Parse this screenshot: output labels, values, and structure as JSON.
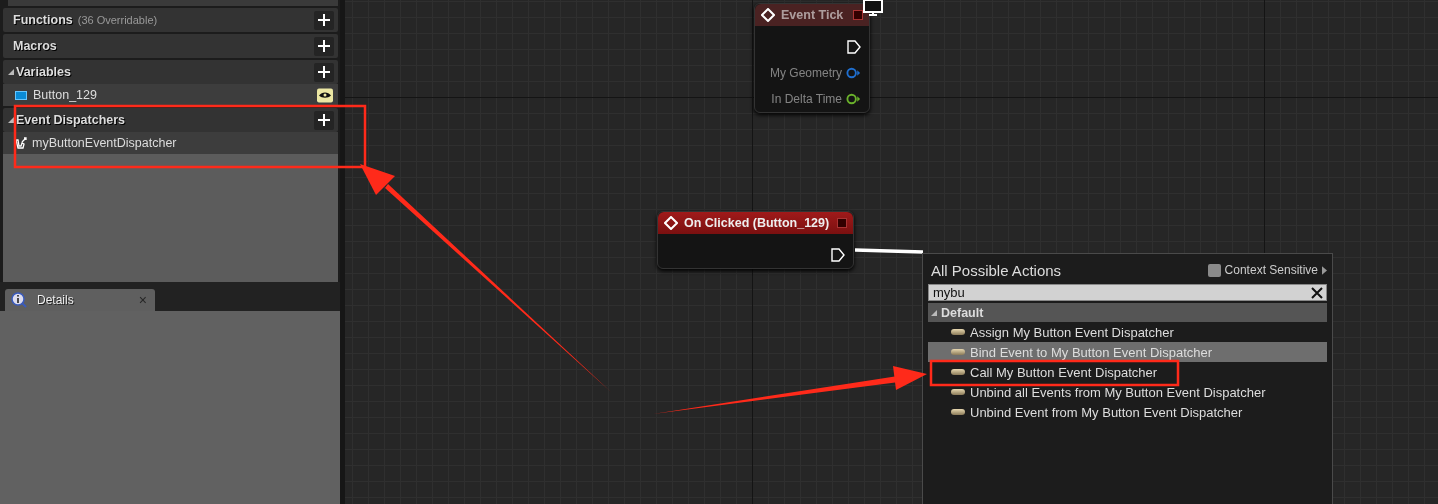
{
  "my_blueprint": {
    "sections": [
      {
        "title": "Functions",
        "note": "(36 Overridable)"
      },
      {
        "title": "Macros"
      },
      {
        "title": "Variables",
        "expanded": true,
        "items": [
          {
            "label": "Button_129",
            "kind": "variable",
            "color": "#0a8bd6"
          }
        ]
      },
      {
        "title": "Event Dispatchers",
        "expanded": true,
        "items": [
          {
            "label": "myButtonEventDispatcher",
            "kind": "dispatcher"
          }
        ]
      }
    ]
  },
  "details_tab": {
    "title": "Details",
    "close": "×"
  },
  "graph": {
    "nodes": [
      {
        "title": "Event Tick",
        "disabled": true,
        "pins": [
          {
            "kind": "exec"
          },
          {
            "kind": "data",
            "label": "My Geometry",
            "color": "#1f6fd0"
          },
          {
            "kind": "data",
            "label": "In Delta Time",
            "color": "#6ab22b"
          }
        ]
      },
      {
        "title": "On Clicked (Button_129)",
        "disabled": false,
        "pins": [
          {
            "kind": "exec"
          }
        ]
      }
    ]
  },
  "action_menu": {
    "title": "All Possible Actions",
    "context_sensitive": {
      "label": "Context Sensitive",
      "checked": false
    },
    "search": {
      "value": "mybu"
    },
    "categories": [
      {
        "label": "Default",
        "expanded": true,
        "items": [
          {
            "label": "Assign My Button Event Dispatcher",
            "selected": false
          },
          {
            "label": "Bind Event to My Button Event Dispatcher",
            "selected": true
          },
          {
            "label": "Call My Button Event Dispatcher",
            "selected": false
          },
          {
            "label": "Unbind all Events from My Button Event Dispatcher",
            "selected": false
          },
          {
            "label": "Unbind Event from My Button Event Dispatcher",
            "selected": false
          }
        ]
      }
    ]
  }
}
